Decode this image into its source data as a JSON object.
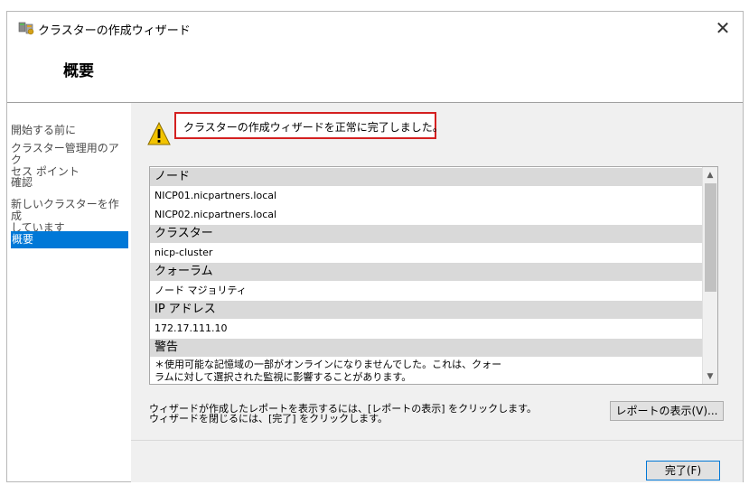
{
  "window": {
    "title": "クラスターの作成ウィザード",
    "close_symbol": "✕"
  },
  "header": {
    "title": "概要"
  },
  "nav": {
    "items": [
      {
        "label": "開始する前に"
      },
      {
        "label_line1": "クラスター管理用のアク",
        "label_line2": "セス ポイント"
      },
      {
        "label": "確認"
      },
      {
        "label_line1": "新しいクラスターを作成",
        "label_line2": "しています"
      },
      {
        "label": "概要"
      }
    ]
  },
  "content": {
    "success_message": "クラスターの作成ウィザードを正常に完了しました。",
    "report": {
      "sections": [
        {
          "heading": "ノード",
          "rows": [
            "NICP01.nicpartners.local",
            "NICP02.nicpartners.local"
          ]
        },
        {
          "heading": "クラスター",
          "rows": [
            "nicp-cluster"
          ]
        },
        {
          "heading": "クォーラム",
          "rows": [
            "ノード マジョリティ"
          ]
        },
        {
          "heading": "IP アドレス",
          "rows": [
            "172.17.111.10"
          ]
        },
        {
          "heading": "警告",
          "lines": [
            "＊使用可能な記憶域の一部がオンラインになりませんでした。これは、クォー",
            "ラムに対して選択された監視に影響することがあります。"
          ]
        }
      ]
    },
    "info_line1": "ウィザードが作成したレポートを表示するには、[レポートの表示] をクリックします。",
    "info_line2": "ウィザードを閉じるには、[完了] をクリックします。",
    "view_report_button": "レポートの表示(V)...",
    "finish_button": "完了(F)"
  },
  "colors": {
    "accent": "#0078d7",
    "highlight_border": "#d42020",
    "section_bg": "#d9d9d9"
  }
}
